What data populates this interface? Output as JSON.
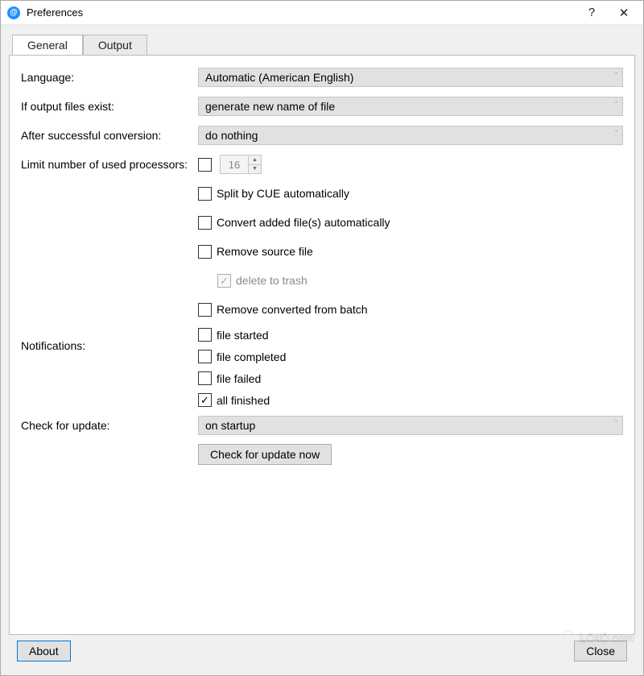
{
  "window": {
    "title": "Preferences"
  },
  "tabs": {
    "general": "General",
    "output": "Output"
  },
  "labels": {
    "language": "Language:",
    "ifExist": "If output files exist:",
    "afterConv": "After successful conversion:",
    "limitProc": "Limit number of used processors:",
    "notifications": "Notifications:",
    "checkUpdate": "Check for update:"
  },
  "values": {
    "language": "Automatic (American English)",
    "ifExist": "generate new name of file",
    "afterConv": "do nothing",
    "procCount": "16",
    "checkUpdate": "on startup"
  },
  "checks": {
    "splitCue": "Split by CUE automatically",
    "convertAuto": "Convert added file(s) automatically",
    "removeSource": "Remove source file",
    "deleteTrash": "delete to trash",
    "removeConverted": "Remove converted from batch",
    "fileStarted": "file started",
    "fileCompleted": "file completed",
    "fileFailed": "file failed",
    "allFinished": "all finished"
  },
  "buttons": {
    "checkNow": "Check for update now",
    "about": "About",
    "close": "Close"
  },
  "watermark": "LO4D.com"
}
